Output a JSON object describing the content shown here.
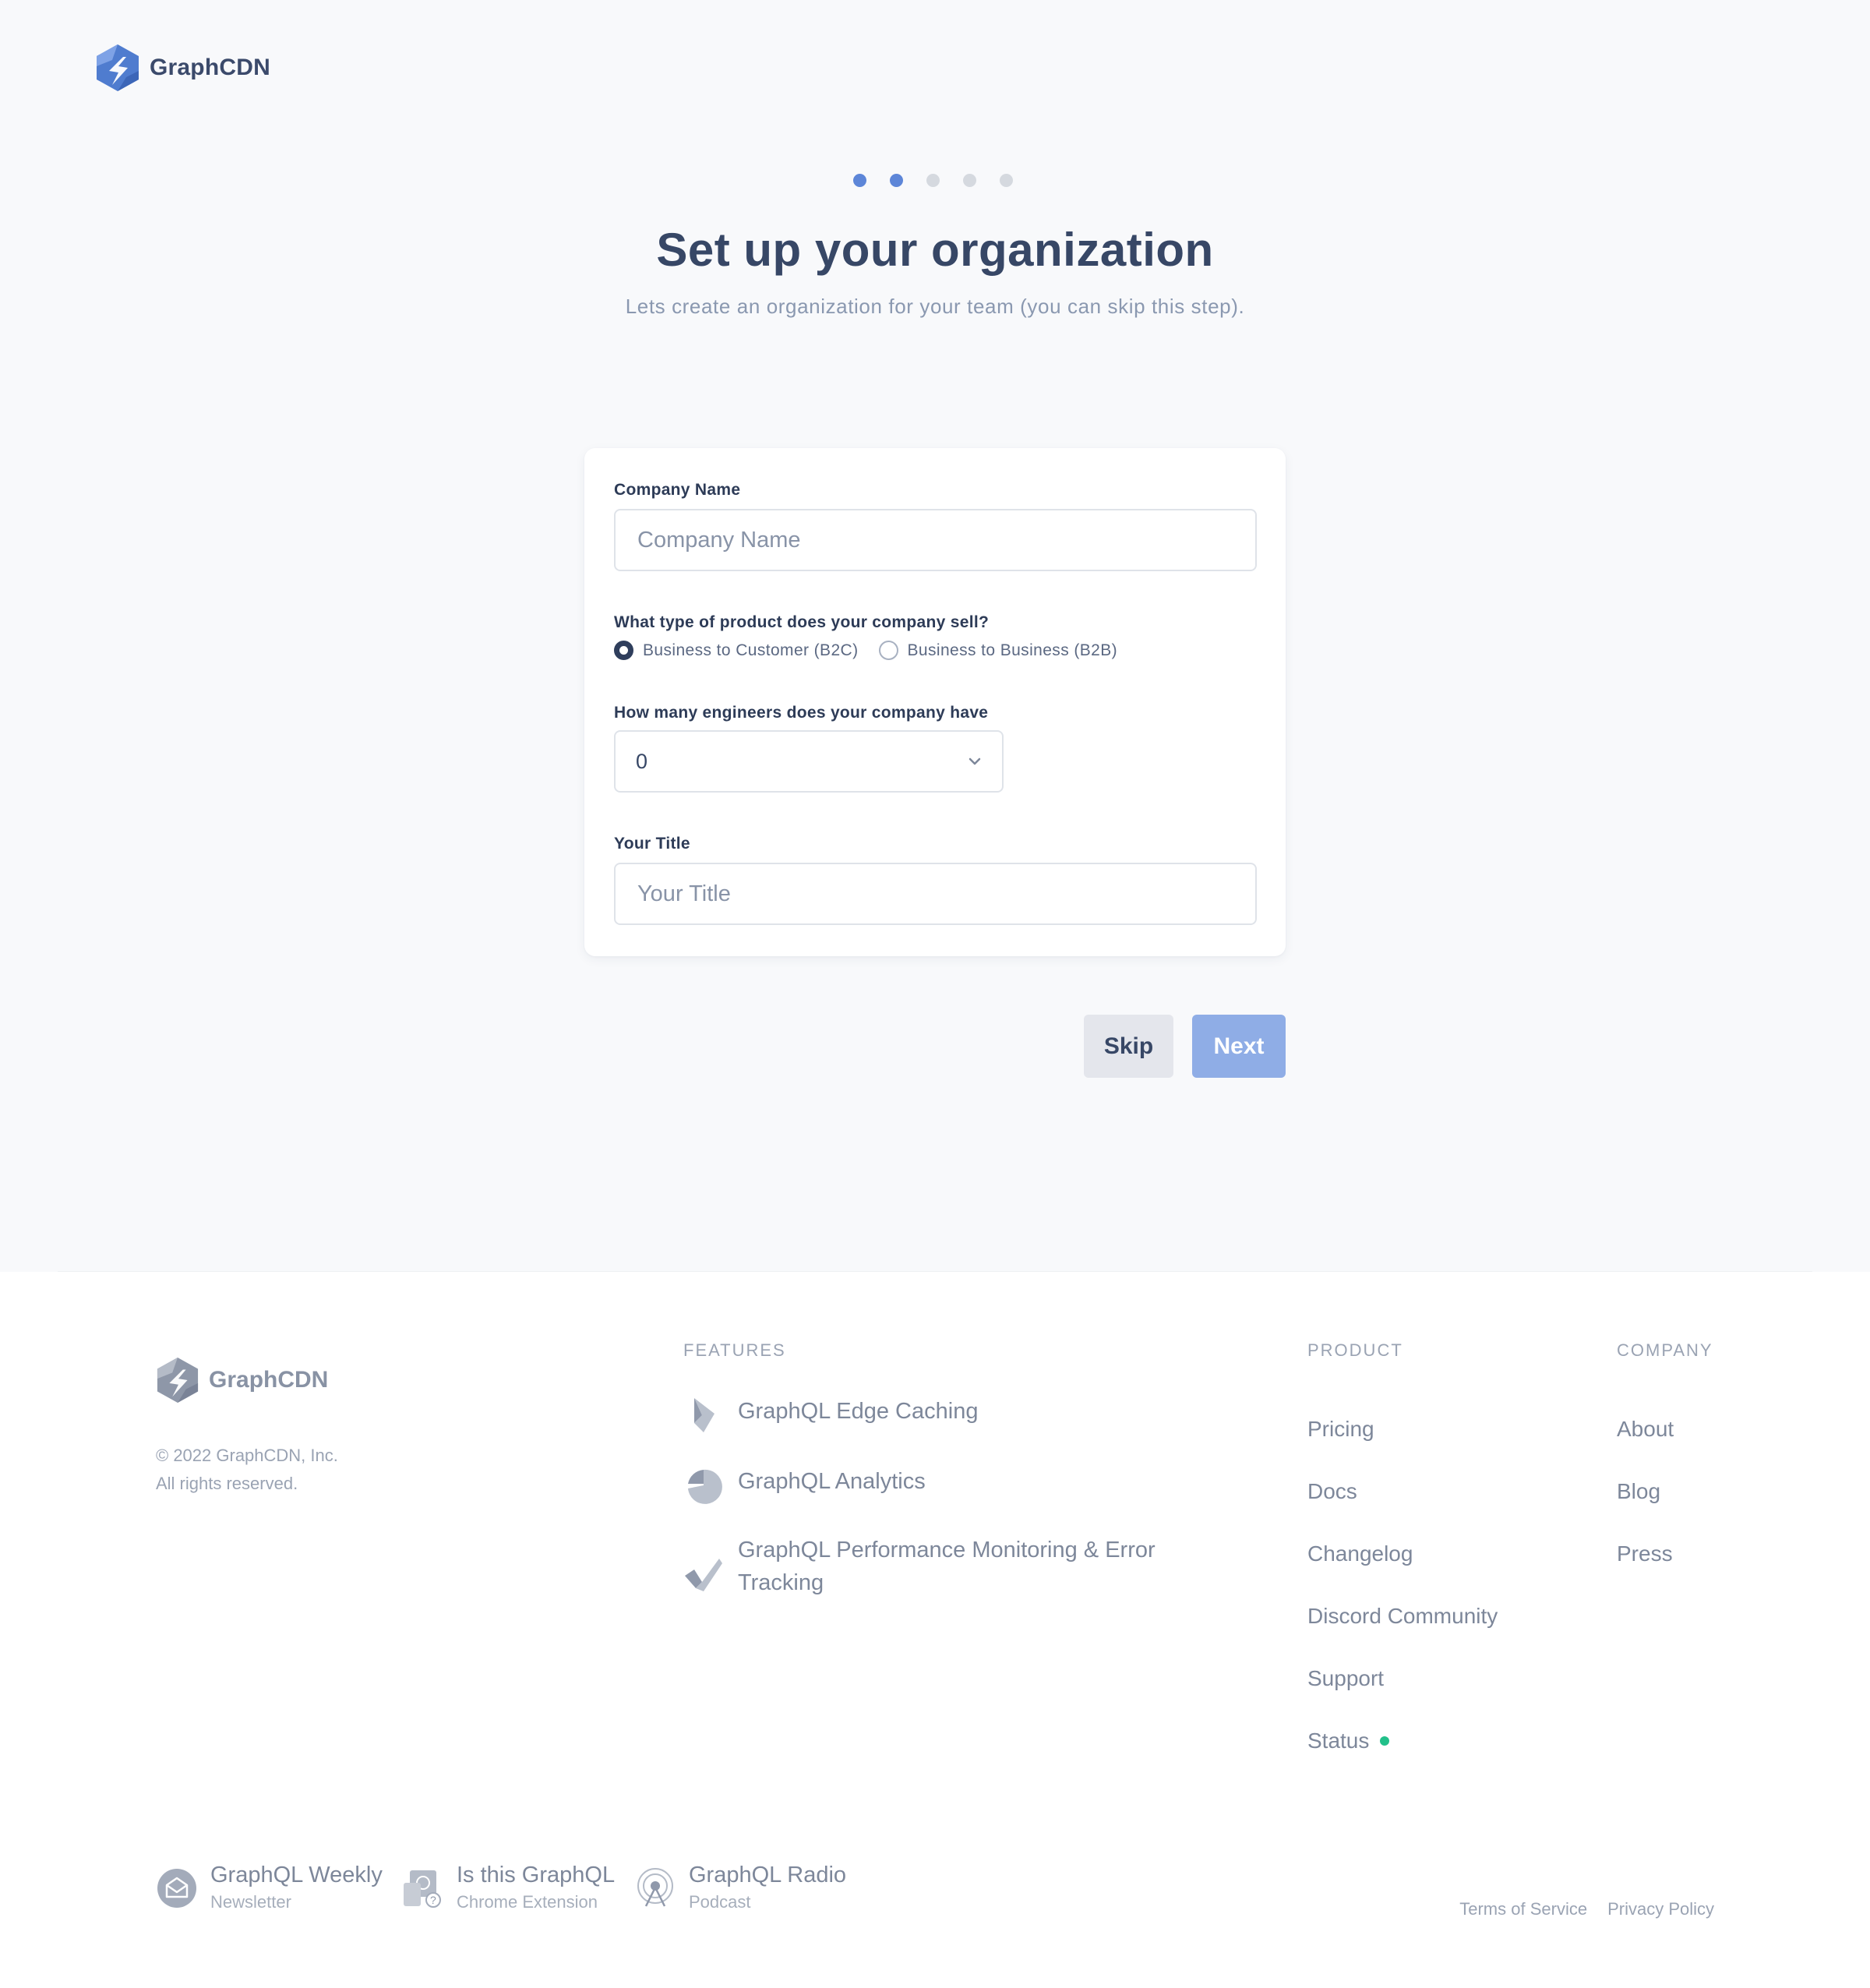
{
  "header": {
    "brand": "GraphCDN"
  },
  "stepper": {
    "total": 5,
    "current": 2
  },
  "page": {
    "title": "Set up your organization",
    "subtitle": "Lets create an organization for your team (you can skip this step)."
  },
  "form": {
    "company_name": {
      "label": "Company Name",
      "placeholder": "Company Name",
      "value": ""
    },
    "product_type": {
      "label": "What type of product does your company sell?",
      "options": [
        {
          "label": "Business to Customer (B2C)",
          "selected": true
        },
        {
          "label": "Business to Business (B2B)",
          "selected": false
        }
      ]
    },
    "engineers": {
      "label": "How many engineers does your company have",
      "value": "0"
    },
    "title": {
      "label": "Your Title",
      "placeholder": "Your Title",
      "value": ""
    }
  },
  "actions": {
    "skip": "Skip",
    "next": "Next"
  },
  "footer": {
    "brand": "GraphCDN",
    "copyright_line1": "© 2022 GraphCDN, Inc.",
    "copyright_line2": "All rights reserved.",
    "features": {
      "heading": "FEATURES",
      "items": [
        {
          "label": "GraphQL Edge Caching",
          "icon": "edge-caching-icon"
        },
        {
          "label": "GraphQL Analytics",
          "icon": "analytics-icon"
        },
        {
          "label": "GraphQL Performance Monitoring & Error Tracking",
          "icon": "monitoring-icon"
        }
      ]
    },
    "product": {
      "heading": "PRODUCT",
      "links": [
        "Pricing",
        "Docs",
        "Changelog",
        "Discord Community",
        "Support",
        "Status"
      ]
    },
    "company": {
      "heading": "COMPANY",
      "links": [
        "About",
        "Blog",
        "Press"
      ]
    },
    "resources": [
      {
        "title": "GraphQL Weekly",
        "subtitle": "Newsletter",
        "icon": "newsletter-icon"
      },
      {
        "title": "Is this GraphQL",
        "subtitle": "Chrome Extension",
        "icon": "extension-icon"
      },
      {
        "title": "GraphQL Radio",
        "subtitle": "Podcast",
        "icon": "podcast-icon"
      }
    ],
    "legal": {
      "terms": "Terms of Service",
      "privacy": "Privacy Policy"
    }
  },
  "colors": {
    "accent": "#5d86d8",
    "next_button": "#8fade6",
    "status_ok": "#22c08a",
    "heading": "#374766"
  }
}
